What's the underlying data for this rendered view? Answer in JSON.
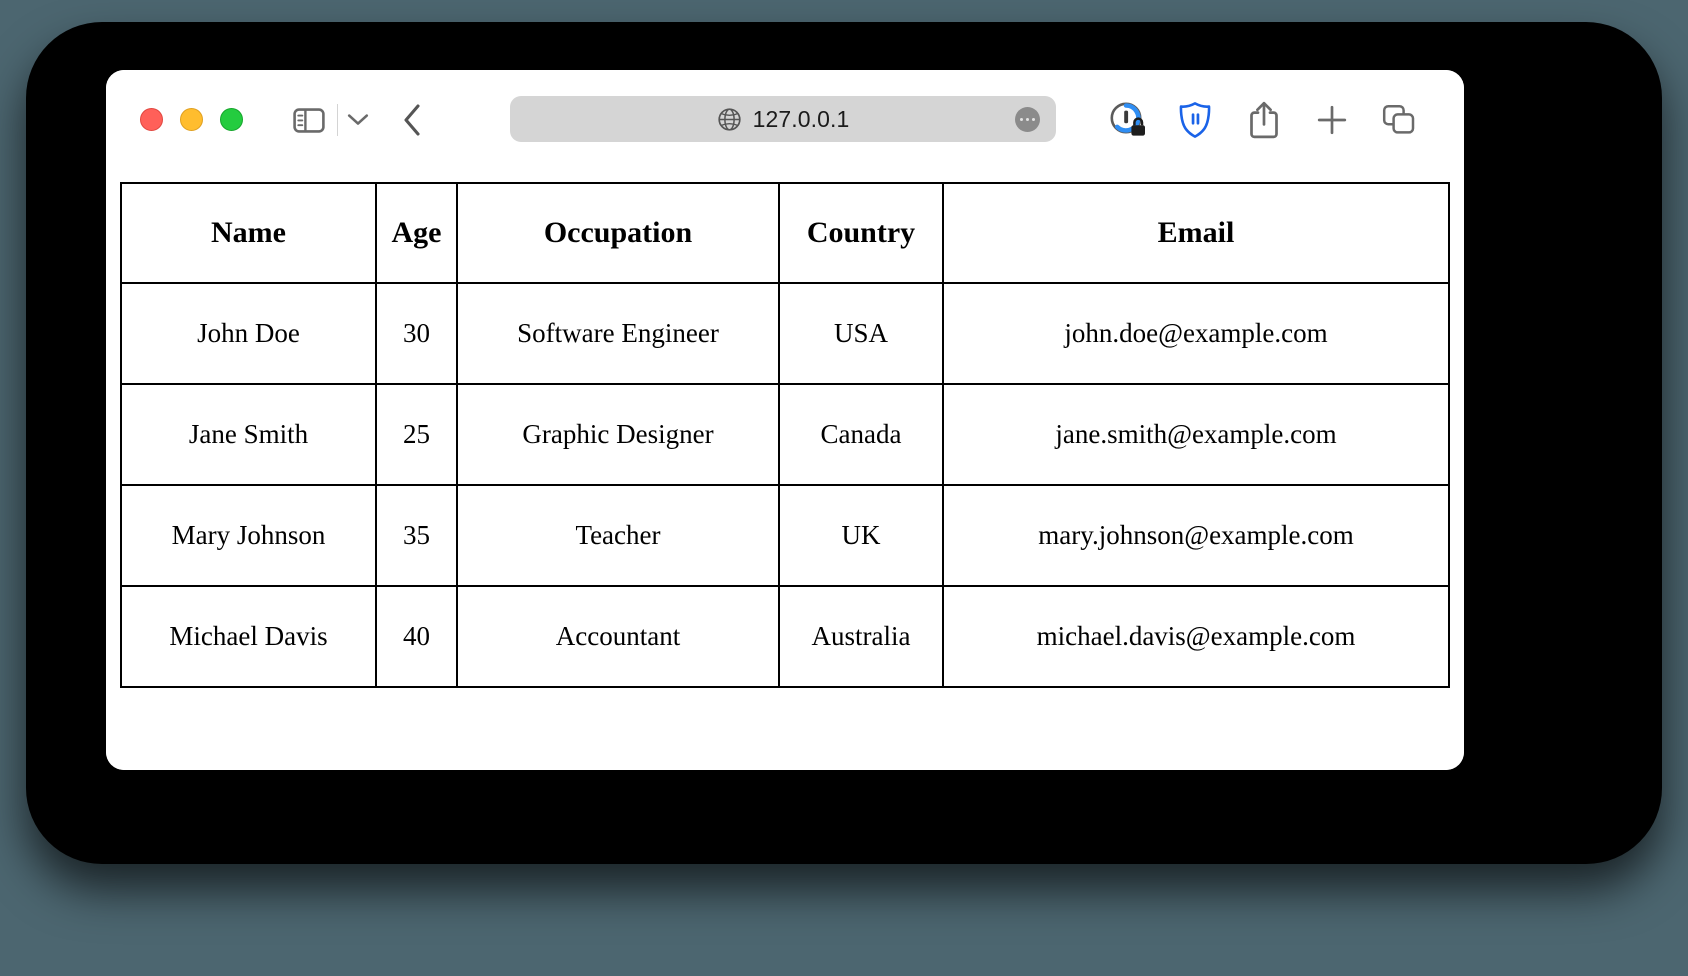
{
  "browser": {
    "url_value": "127.0.0.1",
    "url_placeholder": "Search or enter website name",
    "globe_icon": "globe-icon",
    "more_icon": "ellipsis-icon",
    "traffic_lights": [
      {
        "name": "close",
        "color": "#ff6059"
      },
      {
        "name": "minimize",
        "color": "#ffbd2e"
      },
      {
        "name": "zoom",
        "color": "#24cc3f"
      }
    ],
    "toolbar_left": [
      {
        "name": "sidebar-toggle",
        "icon": "sidebar-icon"
      },
      {
        "name": "sidebar-menu",
        "icon": "chevron-down-icon"
      },
      {
        "name": "back",
        "icon": "chevron-left-icon"
      }
    ],
    "toolbar_right": [
      {
        "name": "privacy-report",
        "icon": "privacy-report-lock-icon",
        "color": "#2f8ef4"
      },
      {
        "name": "content-blocker",
        "icon": "shield-pause-icon",
        "color": "#1a63e8"
      },
      {
        "name": "share",
        "icon": "share-arrow-up-icon"
      },
      {
        "name": "new-tab",
        "icon": "plus-icon"
      },
      {
        "name": "tab-overview",
        "icon": "tab-overview-icon"
      }
    ],
    "accent_color": "#1a63e8",
    "backdrop_color": "#4c6670"
  },
  "table": {
    "headers": [
      "Name",
      "Age",
      "Occupation",
      "Country",
      "Email"
    ],
    "rows": [
      {
        "name": "John Doe",
        "age": "30",
        "occupation": "Software Engineer",
        "country": "USA",
        "email": "john.doe@example.com"
      },
      {
        "name": "Jane Smith",
        "age": "25",
        "occupation": "Graphic Designer",
        "country": "Canada",
        "email": "jane.smith@example.com"
      },
      {
        "name": "Mary Johnson",
        "age": "35",
        "occupation": "Teacher",
        "country": "UK",
        "email": "mary.johnson@example.com"
      },
      {
        "name": "Michael Davis",
        "age": "40",
        "occupation": "Accountant",
        "country": "Australia",
        "email": "michael.davis@example.com"
      }
    ]
  }
}
